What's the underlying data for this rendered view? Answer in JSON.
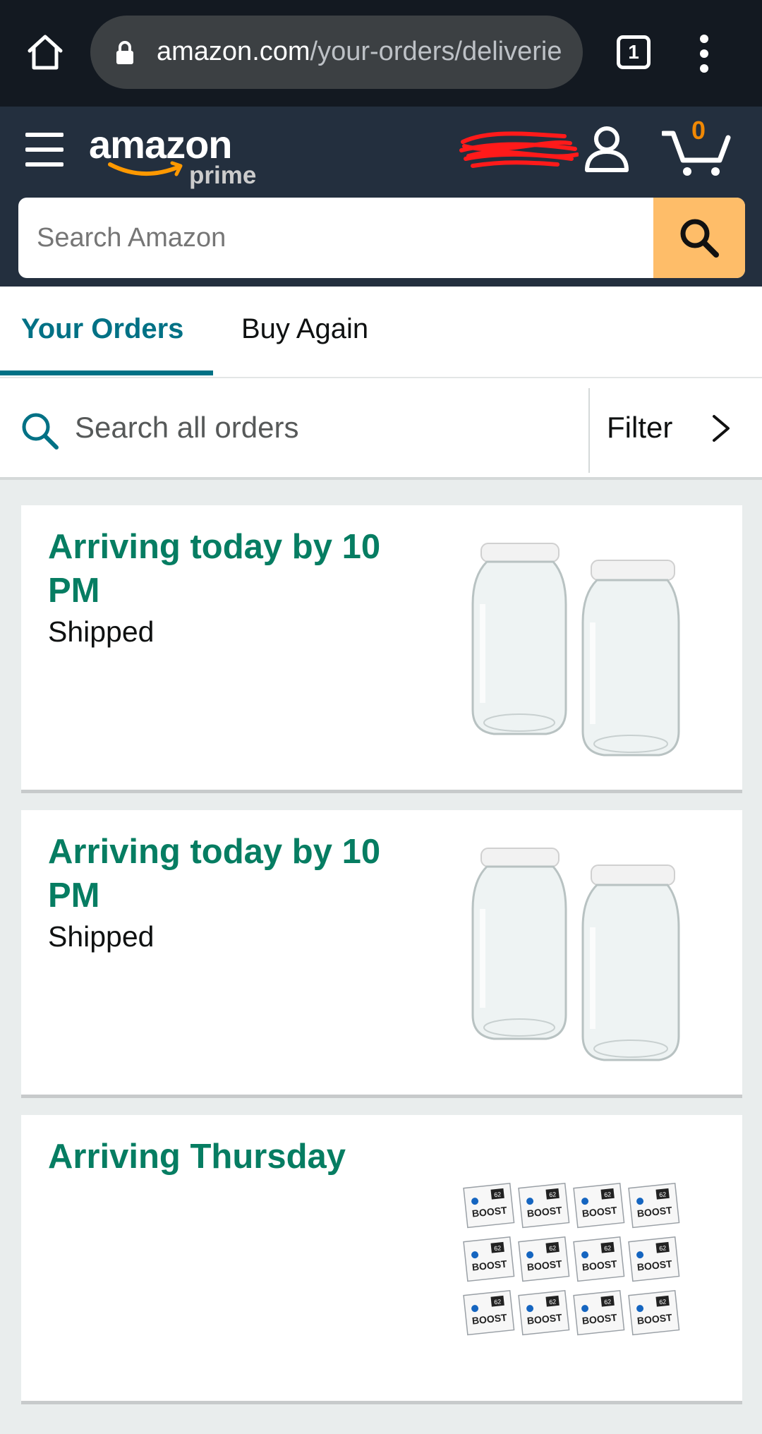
{
  "browser": {
    "url_host": "amazon.com",
    "url_path": "/your-orders/deliverie",
    "tab_count": "1"
  },
  "header": {
    "logo_word": "amazon",
    "logo_prime": "prime",
    "cart_count": "0",
    "search_placeholder": "Search Amazon"
  },
  "tabs": [
    {
      "label": "Your Orders",
      "active": true
    },
    {
      "label": "Buy Again",
      "active": false
    }
  ],
  "order_search": {
    "placeholder": "Search all orders",
    "filter_label": "Filter"
  },
  "orders": [
    {
      "title": "Arriving today by 10 PM",
      "status": "Shipped",
      "image": "glass-jars"
    },
    {
      "title": "Arriving today by 10 PM",
      "status": "Shipped",
      "image": "glass-jars"
    },
    {
      "title": "Arriving Thursday",
      "status": "",
      "image": "boost-packs",
      "pack_label": "BOOST",
      "pack_number": "62"
    }
  ],
  "colors": {
    "chrome_bg": "#131921",
    "header_bg": "#232f3e",
    "accent_teal": "#007185",
    "title_green": "#067d62",
    "search_button": "#febd69",
    "cart_count": "#f08804"
  }
}
